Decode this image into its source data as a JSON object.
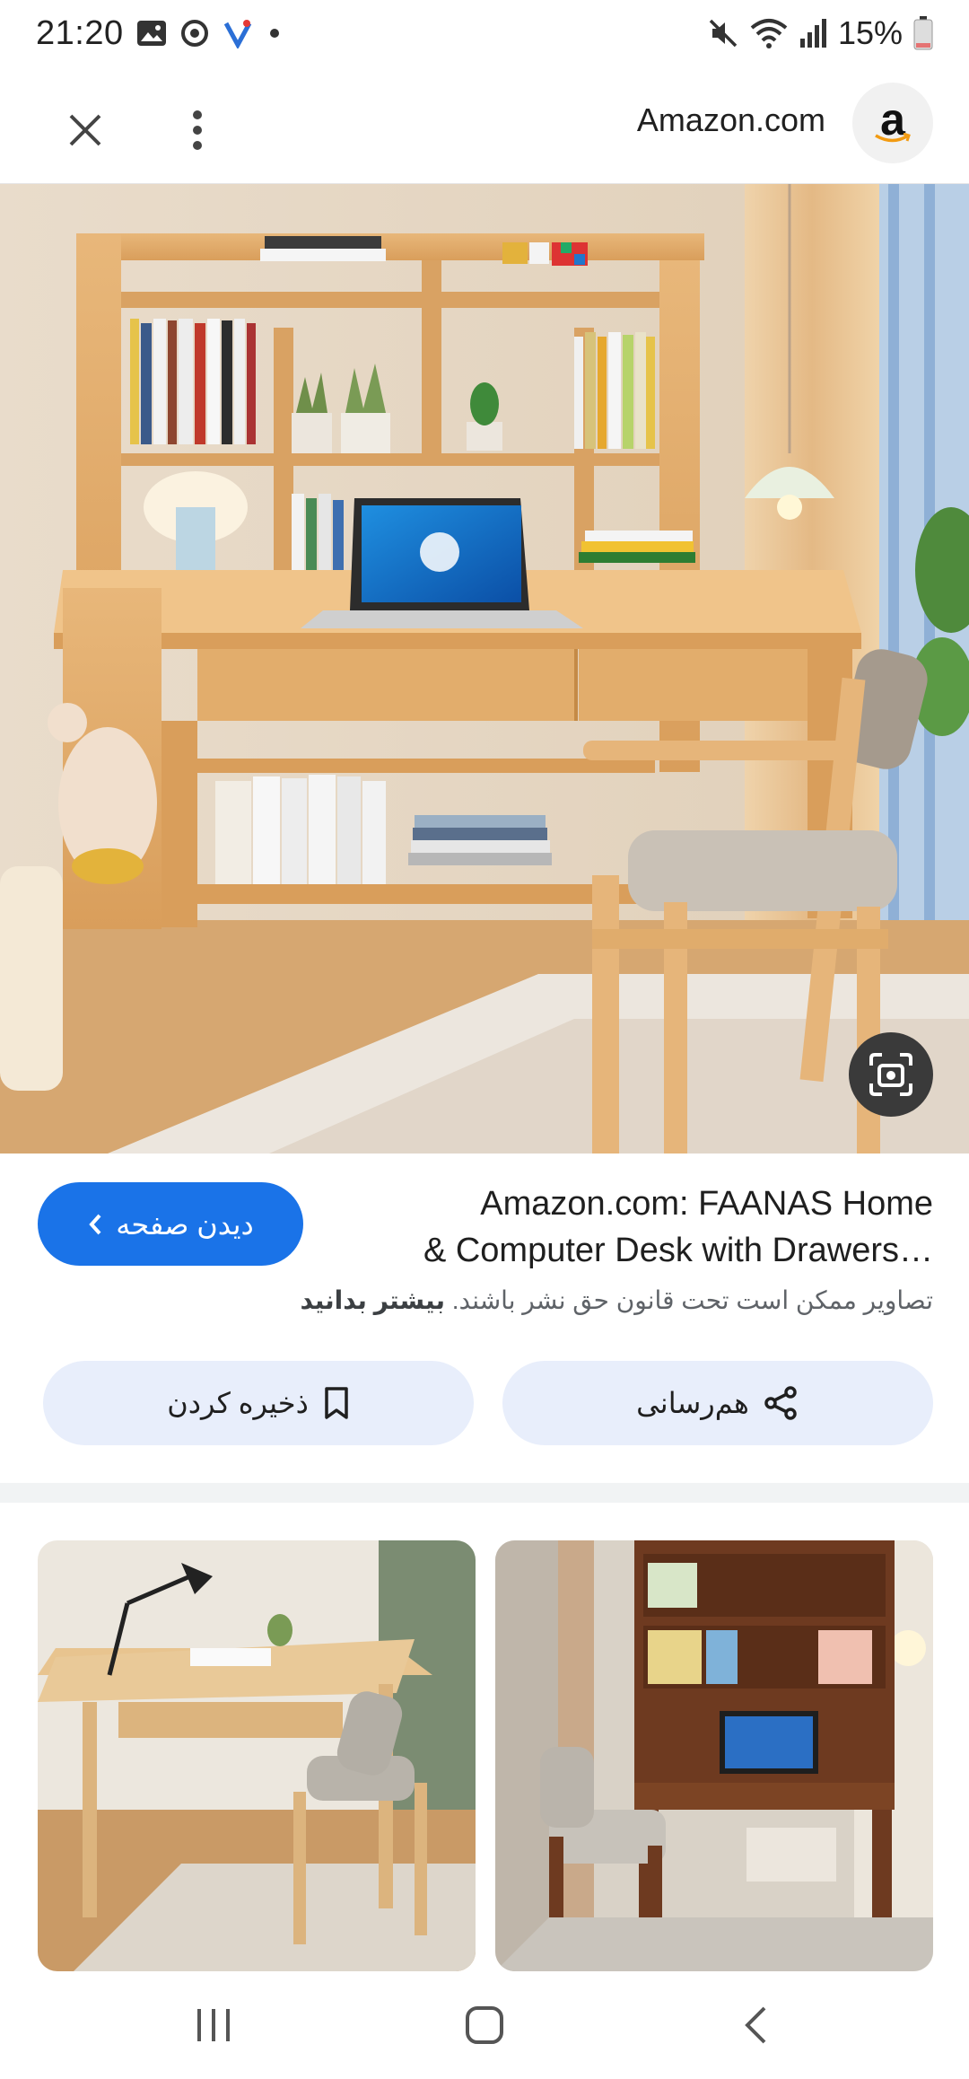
{
  "status": {
    "time": "21:20",
    "battery": "15%"
  },
  "toolbar": {
    "site_name": "Amazon.com",
    "logo_letter": "a"
  },
  "result": {
    "title_line1": "Amazon.com: FAANAS Home",
    "title_line2": "& Computer Desk with Drawers…",
    "visit_label": "دیدن صفحه",
    "copyright_text": "تصاویر ممکن است تحت قانون حق نشر باشند.",
    "learn_more": "بیشتر بدانید"
  },
  "actions": {
    "share_label": "هم‌رسانی",
    "save_label": "ذخیره کردن"
  },
  "colors": {
    "accent": "#1a73e8",
    "chip": "#e8eefb"
  },
  "icons": [
    "close-icon",
    "more-vert-icon",
    "amazon-logo",
    "lens-icon",
    "chevron-left-icon",
    "share-icon",
    "bookmark-icon",
    "recents-icon",
    "home-icon",
    "back-icon"
  ]
}
